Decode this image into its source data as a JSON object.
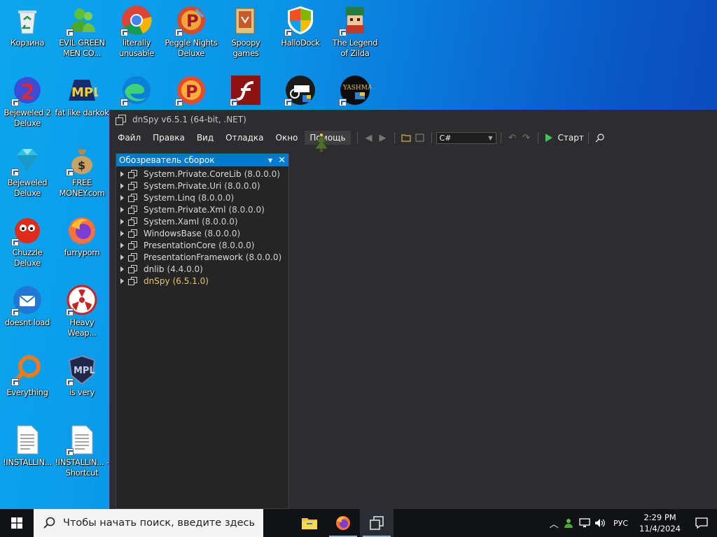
{
  "desktop": {
    "icons": [
      {
        "label": "Корзина",
        "icon": "recycle-bin-icon"
      },
      {
        "label": "EVIL GREEN MEN CO...",
        "icon": "people-icon"
      },
      {
        "label": "literally unusable",
        "icon": "chrome-icon"
      },
      {
        "label": "Peggle Nights Deluxe",
        "icon": "peggle-icon"
      },
      {
        "label": "Spoopy games",
        "icon": "folder-icon"
      },
      {
        "label": "HalloDock",
        "icon": "windows-shield-icon"
      },
      {
        "label": "The Legend of Zilda",
        "icon": "game-character-icon"
      },
      {
        "label": "Bejeweled 2 Deluxe",
        "icon": "bejeweled2-icon"
      },
      {
        "label": "fat like darkok",
        "icon": "mpl-icon"
      },
      {
        "label": "",
        "icon": "edge-icon"
      },
      {
        "label": "",
        "icon": "peggle-icon"
      },
      {
        "label": "",
        "icon": "flash-icon"
      },
      {
        "label": "",
        "icon": "dark-app-icon"
      },
      {
        "label": "",
        "icon": "yashma-icon"
      },
      {
        "label": "Bejeweled Deluxe",
        "icon": "diamond-icon"
      },
      {
        "label": "FREE MONEY.com",
        "icon": "money-bag-icon"
      },
      {
        "label": "Chuzzle Deluxe",
        "icon": "chuzzle-icon"
      },
      {
        "label": "furryporn",
        "icon": "firefox-icon"
      },
      {
        "label": "doesnt load",
        "icon": "thunderbird-icon"
      },
      {
        "label": "Heavy Weap...",
        "icon": "radiation-icon"
      },
      {
        "label": "Everything",
        "icon": "search-app-icon"
      },
      {
        "label": "is very",
        "icon": "mpl-shield-icon"
      },
      {
        "label": "!INSTALLIN...",
        "icon": "document-icon"
      },
      {
        "label": "!INSTALLIN... - Shortcut",
        "icon": "document-icon"
      }
    ]
  },
  "window": {
    "title": "dnSpy v6.5.1 (64-bit, .NET)",
    "menu": [
      "Файл",
      "Правка",
      "Вид",
      "Отладка",
      "Окно",
      "Помощь"
    ],
    "language": "C#",
    "start_label": "Старт",
    "explorer": {
      "title": "Обозреватель сборок",
      "assemblies": [
        {
          "name": "System.Private.CoreLib",
          "version": "(8.0.0.0)"
        },
        {
          "name": "System.Private.Uri",
          "version": "(8.0.0.0)"
        },
        {
          "name": "System.Linq",
          "version": "(8.0.0.0)"
        },
        {
          "name": "System.Private.Xml",
          "version": "(8.0.0.0)"
        },
        {
          "name": "System.Xaml",
          "version": "(8.0.0.0)"
        },
        {
          "name": "WindowsBase",
          "version": "(8.0.0.0)"
        },
        {
          "name": "PresentationCore",
          "version": "(8.0.0.0)"
        },
        {
          "name": "PresentationFramework",
          "version": "(8.0.0.0)"
        },
        {
          "name": "dnlib",
          "version": "(4.4.0.0)"
        },
        {
          "name": "dnSpy",
          "version": "(6.5.1.0)"
        }
      ]
    }
  },
  "taskbar": {
    "search_placeholder": "Чтобы начать поиск, введите здесь",
    "language": "РУС",
    "time": "2:29 PM",
    "date": "11/4/2024"
  },
  "colors": {
    "accent": "#007acc",
    "window_bg": "#2d2d30",
    "highlight_assembly": "#e8c46b"
  }
}
